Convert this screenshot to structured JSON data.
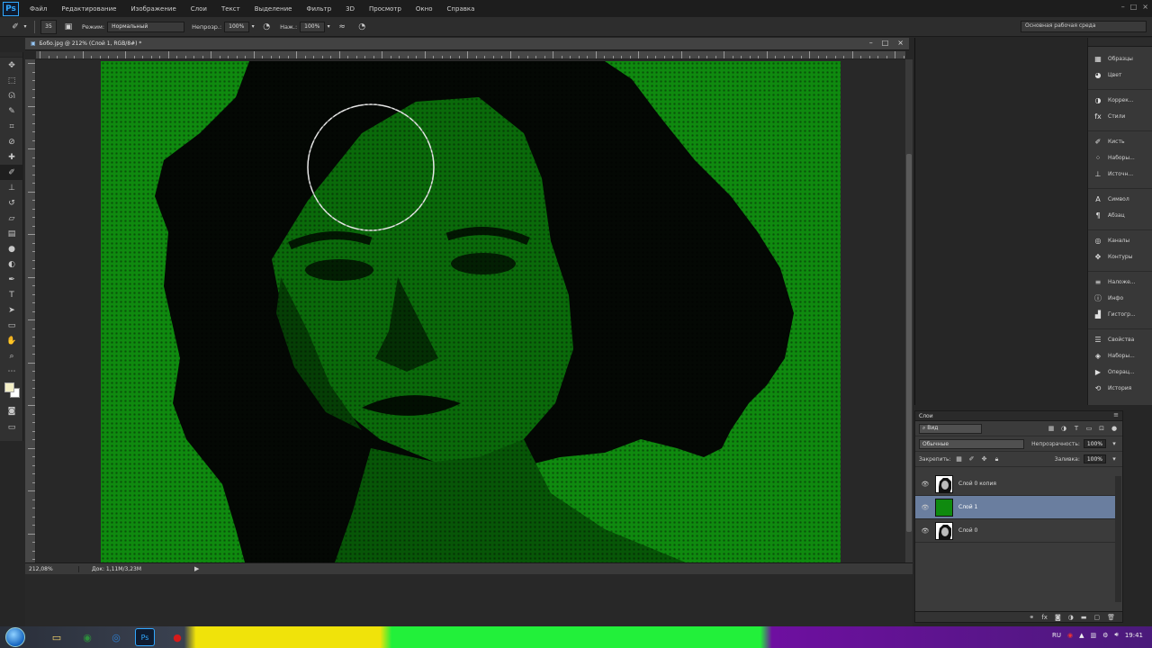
{
  "app": {
    "logo_text": "Ps"
  },
  "menu": [
    "Файл",
    "Редактирование",
    "Изображение",
    "Слои",
    "Текст",
    "Выделение",
    "Фильтр",
    "3D",
    "Просмотр",
    "Окно",
    "Справка"
  ],
  "window_controls": [
    "–",
    "□",
    "×"
  ],
  "options_bar": {
    "brush_size": "35",
    "mode_label": "Режим:",
    "mode_value": "Нормальный",
    "opacity_label": "Непрозр.:",
    "opacity_value": "100%",
    "flow_label": "Наж.:",
    "flow_value": "100%",
    "workspace": "Основная рабочая среда"
  },
  "document": {
    "tab_title": "Бобо.jpg @ 212% (Слой 1, RGB/8#) *",
    "controls": [
      "–",
      "□",
      "×"
    ]
  },
  "status": {
    "zoom": "212,08%",
    "doc_size": "Док: 1,11М/3,23М",
    "arrow": "▶"
  },
  "ruler_numbers": [
    "",
    "",
    "",
    "",
    "",
    "",
    "",
    "",
    "",
    "",
    "",
    "",
    "",
    "",
    "",
    "",
    "",
    "",
    "",
    ""
  ],
  "tools": [
    {
      "name": "move-tool-icon",
      "glyph": "✥"
    },
    {
      "name": "marquee-tool-icon",
      "glyph": "⬚"
    },
    {
      "name": "lasso-tool-icon",
      "glyph": "ᘏ"
    },
    {
      "name": "quick-select-tool-icon",
      "glyph": "✎"
    },
    {
      "name": "crop-tool-icon",
      "glyph": "⌗"
    },
    {
      "name": "eyedropper-tool-icon",
      "glyph": "⊘"
    },
    {
      "name": "healing-brush-tool-icon",
      "glyph": "✚"
    },
    {
      "name": "brush-tool-icon",
      "glyph": "✐",
      "active": true
    },
    {
      "name": "clone-stamp-tool-icon",
      "glyph": "⊥"
    },
    {
      "name": "history-brush-tool-icon",
      "glyph": "↺"
    },
    {
      "name": "eraser-tool-icon",
      "glyph": "▱"
    },
    {
      "name": "gradient-tool-icon",
      "glyph": "▤"
    },
    {
      "name": "blur-tool-icon",
      "glyph": "●"
    },
    {
      "name": "dodge-tool-icon",
      "glyph": "◐"
    },
    {
      "name": "pen-tool-icon",
      "glyph": "✒"
    },
    {
      "name": "type-tool-icon",
      "glyph": "T"
    },
    {
      "name": "path-select-tool-icon",
      "glyph": "➤"
    },
    {
      "name": "shape-tool-icon",
      "glyph": "▭"
    },
    {
      "name": "hand-tool-icon",
      "glyph": "✋"
    },
    {
      "name": "zoom-tool-icon",
      "glyph": "⌕"
    },
    {
      "name": "extra-tool-icon",
      "glyph": "⋯"
    }
  ],
  "panel_strip": [
    {
      "label": "Образцы",
      "icon": "swatches-icon",
      "glyph": "▦"
    },
    {
      "label": "Цвет",
      "icon": "color-icon",
      "glyph": "◕"
    },
    {
      "gap": true
    },
    {
      "label": "Коррек...",
      "icon": "adjustments-icon",
      "glyph": "◑"
    },
    {
      "label": "Стили",
      "icon": "styles-icon",
      "glyph": "fx"
    },
    {
      "gap": true
    },
    {
      "label": "Кисть",
      "icon": "brush-panel-icon",
      "glyph": "✐"
    },
    {
      "label": "Наборы...",
      "icon": "brush-presets-icon",
      "glyph": "⁘"
    },
    {
      "label": "Источн...",
      "icon": "clone-source-icon",
      "glyph": "⊥"
    },
    {
      "gap": true
    },
    {
      "label": "Символ",
      "icon": "character-icon",
      "glyph": "A"
    },
    {
      "label": "Абзац",
      "icon": "paragraph-icon",
      "glyph": "¶"
    },
    {
      "gap": true
    },
    {
      "label": "Каналы",
      "icon": "channels-icon",
      "glyph": "◎"
    },
    {
      "label": "Контуры",
      "icon": "paths-icon",
      "glyph": "✥"
    },
    {
      "gap": true
    },
    {
      "label": "Наложе...",
      "icon": "notes-icon",
      "glyph": "≡"
    },
    {
      "label": "Инфо",
      "icon": "info-icon",
      "glyph": "ⓘ"
    },
    {
      "label": "Гистогр...",
      "icon": "histogram-icon",
      "glyph": "▟"
    },
    {
      "gap": true
    },
    {
      "label": "Свойства",
      "icon": "properties-icon",
      "glyph": "☰"
    },
    {
      "label": "Наборы...",
      "icon": "layer-comps-icon",
      "glyph": "◈"
    },
    {
      "label": "Операц...",
      "icon": "actions-icon",
      "glyph": "▶"
    },
    {
      "label": "История",
      "icon": "history-icon",
      "glyph": "⟲"
    }
  ],
  "layers_panel": {
    "title": "Слои",
    "kind_filter": "⌕ Вид",
    "blend_mode": "Обычные",
    "opacity_label": "Непрозрачность:",
    "opacity_value": "100%",
    "lock_label": "Закрепить:",
    "fill_label": "Заливка:",
    "fill_value": "100%",
    "layers": [
      {
        "name": "Слой 0 копия",
        "thumb": "portrait",
        "selected": false
      },
      {
        "name": "Слой 1",
        "thumb": "green",
        "selected": true
      },
      {
        "name": "Слой 0",
        "thumb": "portrait",
        "selected": false
      }
    ]
  },
  "taskbar": {
    "language": "RU",
    "clock": "19:41"
  },
  "colors": {
    "canvas_green": "#0f8a0f",
    "selected_layer": "#6a7e9f",
    "foreground": "#f3efc6",
    "background": "#ffffff"
  }
}
